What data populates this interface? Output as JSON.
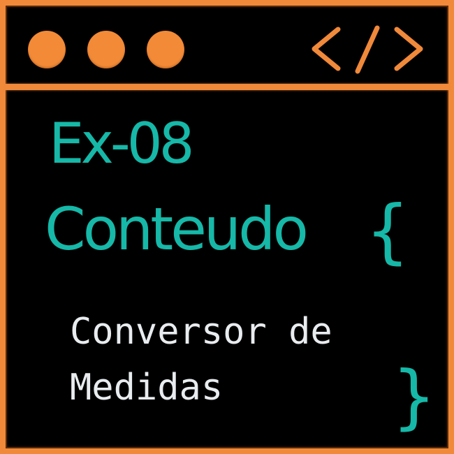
{
  "window": {
    "controls": [
      "dot",
      "dot",
      "dot"
    ],
    "code_icon": "code-brackets-icon",
    "colors": {
      "frame": "#f0893a",
      "background": "#000000",
      "accent": "#16b8a8",
      "text": "#e9ecef"
    }
  },
  "content": {
    "line1": "Ex-08",
    "line2": "Conteudo",
    "open_brace": "{",
    "subtitle_line1": "Conversor de",
    "subtitle_line2": "Medidas",
    "close_brace": "}"
  }
}
